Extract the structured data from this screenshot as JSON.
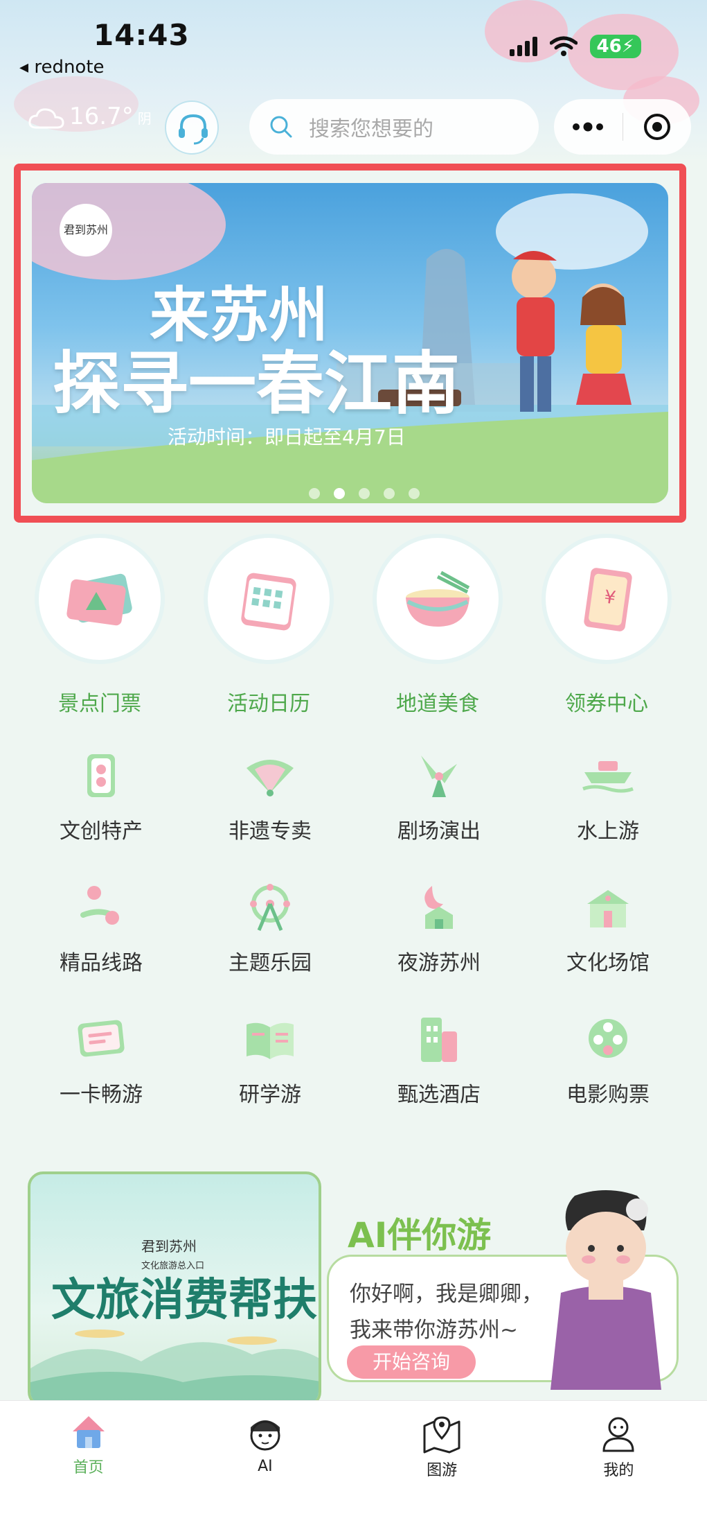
{
  "status_bar": {
    "time": "14:43",
    "back_app": "rednote",
    "battery": "46"
  },
  "header": {
    "weather_temp": "16.7°",
    "weather_desc": "阴",
    "search_placeholder": "搜索您想要的"
  },
  "banner": {
    "title_line1": "来苏州",
    "title_line2": "探寻一春江南",
    "date": "活动时间：即日起至4月7日",
    "logo_text": "君到苏州",
    "page_count": 5,
    "active_page": 2
  },
  "main_categories": [
    {
      "label": "景点门票",
      "icon": "ticket-icon"
    },
    {
      "label": "活动日历",
      "icon": "calendar-icon"
    },
    {
      "label": "地道美食",
      "icon": "noodle-bowl-icon"
    },
    {
      "label": "领券中心",
      "icon": "coupon-icon"
    }
  ],
  "services": [
    {
      "label": "文创特产",
      "icon": "souvenir-icon"
    },
    {
      "label": "非遗专卖",
      "icon": "fan-icon"
    },
    {
      "label": "剧场演出",
      "icon": "theater-icon"
    },
    {
      "label": "水上游",
      "icon": "boat-icon"
    },
    {
      "label": "精品线路",
      "icon": "route-icon"
    },
    {
      "label": "主题乐园",
      "icon": "ferris-wheel-icon"
    },
    {
      "label": "夜游苏州",
      "icon": "moon-night-icon"
    },
    {
      "label": "文化场馆",
      "icon": "museum-icon"
    },
    {
      "label": "一卡畅游",
      "icon": "card-icon"
    },
    {
      "label": "研学游",
      "icon": "book-icon"
    },
    {
      "label": "甄选酒店",
      "icon": "hotel-icon"
    },
    {
      "label": "电影购票",
      "icon": "film-reel-icon"
    }
  ],
  "promo_left": {
    "logo_text": "君到苏州",
    "logo_sub": "文化旅游总入口",
    "title": "文旅消费帮扶"
  },
  "ai_card": {
    "title": "AI伴你游",
    "line1": "你好啊，我是卿卿，",
    "line2": "我来带你游苏州~",
    "button": "开始咨询"
  },
  "tabbar": [
    {
      "label": "首页",
      "icon": "home-icon",
      "active": true
    },
    {
      "label": "AI",
      "icon": "ai-avatar-icon",
      "active": false
    },
    {
      "label": "图游",
      "icon": "map-pin-icon",
      "active": false
    },
    {
      "label": "我的",
      "icon": "user-icon",
      "active": false
    }
  ],
  "colors": {
    "accent_green": "#4ea84b",
    "banner_frame_red": "#f04f55",
    "ai_button_pink": "#f79aa7"
  }
}
